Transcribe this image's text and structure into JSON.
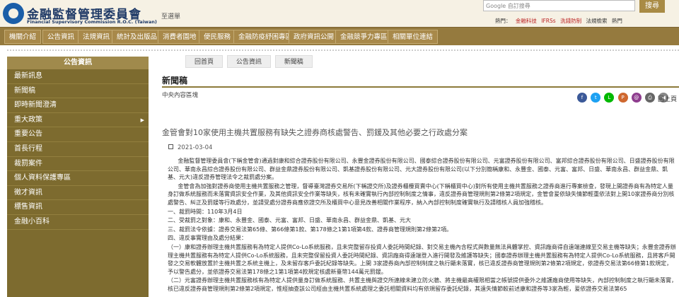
{
  "header": {
    "brand_cn": "金融監督管理委員會",
    "brand_en": "Financial Supervisory Commission R.O.C. (Taiwan)",
    "home_link": "至選單",
    "search_placeholder": "Google 自訂搜尋",
    "search_button": "搜尋",
    "hot_label": "熱門：",
    "hot_links": [
      "金融科技",
      "IFRSs",
      "洗錢防制",
      "法規檢索"
    ],
    "hot_more": "熱門"
  },
  "nav": [
    "機關介紹",
    "公告資訊",
    "法規資訊",
    "統計及出版品",
    "消費者園地",
    "便民服務",
    "金融防疫紓困專區",
    "政府資訊公開",
    "金融競爭力專區",
    "相關單位連結"
  ],
  "sidebar": {
    "title": "公告資訊",
    "items": [
      "最新訊息",
      "新聞稿",
      "即時新聞澄清",
      "重大政策",
      "重要公告",
      "首長行程",
      "裁罰案件",
      "個人資料保護專區",
      "徵才資訊",
      "標售資訊",
      "金融小百科"
    ]
  },
  "breadcrumb": [
    "回首頁",
    "公告資訊",
    "新聞稿"
  ],
  "page": {
    "title": "新聞稿",
    "unit": "中央內容區塊",
    "back": "回上頁",
    "share_icons": [
      "facebook-icon",
      "twitter-icon",
      "line-icon",
      "plurk-icon",
      "email-icon",
      "print-icon"
    ],
    "article_title": "金管會對10家使用主機共置服務有缺失之證券商核處警告、罰鍰及其他必要之行政處分案",
    "date": "2021-03-04"
  },
  "article": {
    "p1": "金融監督管理委員會(下稱金管會)通過對康和綜合證券股份有限公司、永豐金證券股份有限公司、國泰綜合證券股份有限公司、元富證券股份有限公司、富邦綜合證券股份有限公司、日盛證券股份有限公司、華南永昌綜合證券股份有限公司、群益金鼎證券股份有限公司、凱基證券股份有限公司、元大證券股份有限公司(以下分別簡稱康和、永豐金、國泰、元富、富邦、日盛、華南永昌、群益金鼎、凱基、元大)違反證券管理法令之裁罰處分案。",
    "p2": "金管會為加強對證券商使用主機共置服務之管理，督導臺灣證券交易所(下稱證交所)及證券櫃檯買賣中心(下稱櫃買中心)對所有使用主機共置服務之證券商進行專案檢查，發現上開證券商有為特定人量身訂做系統服務而未落實資訊安全作業，及其他資訊安全作業等缺失，核有未確實執行內部控制制度之情事，違反證券商管理規則第2條第2項規定，金管會爰依缺失情節輕重依法對上開10家證券商分別核處警告、糾正及罰鍰等行政處分，並請受處分證券商應依證交所及櫃買中心意見改善相關作業程序，納入內部控制制度確實執行及請稽核人員加強稽核。",
    "l1": "一、裁罰時間：110年3月4日",
    "l2": "二、受裁罰之對象：康和、永豐金、國泰、元富、富邦、日盛、華南永昌、群益金鼎、凱基、元大",
    "l3": "三、裁罰法令依據：證券交易法第65條、第66條第1款、第178條之1第1項第4款、證券商管理規則第2條第2項。",
    "l4": "四、違反事實理由及處分結果：",
    "p3": "（一）康和證券辦理主機共置服務有為特定人提供Co-Lo系統服務，且未完整留存投資人委託時間紀錄、對交易主機內含程式與數量無法具體掌控、資訊廠商得自遠端連線至交易主機等缺失；永豐金證券辦理主機共置服務有為特定人提供Co-Lo系統服務，且未完整保留投資人委託時間紀錄、資訊廠商得遠端登入進行開發及維護等缺失；國泰證券辦理主機共置服務有為特定人提供Co-Lo系統服務，且將客戶開發之交易軟體放置於主機共置之系統主機上，及未留存客戶委託紀錄等缺失。上開 3家證券商內部控制制度之執行顯未落實，核已違反證券商管理規則第2條第2項規定，依證券交易法第66條第1款規定，予以警告處分，並依證券交易法第178條之1第1項第4款規定核處新臺幣144萬元罰鍰。",
    "p4": "（二）元富證券辦理主機共置服務核有為特定人提供量身訂做系統服務、共置主機與證交所連線未建立防火牆、將主機最高權限相當之帳號提供委外之維護廠商使用等缺失，內部控制制度之執行顯未落實，核已違反證券商管理規則第2條第2項規定，惟經抽查該公司經由主機共置系統處理之委託相關資料均有依規留存委託紀錄，其遠失情節較前述康和證券等3家為輕，爰依證券交易法第65"
  }
}
